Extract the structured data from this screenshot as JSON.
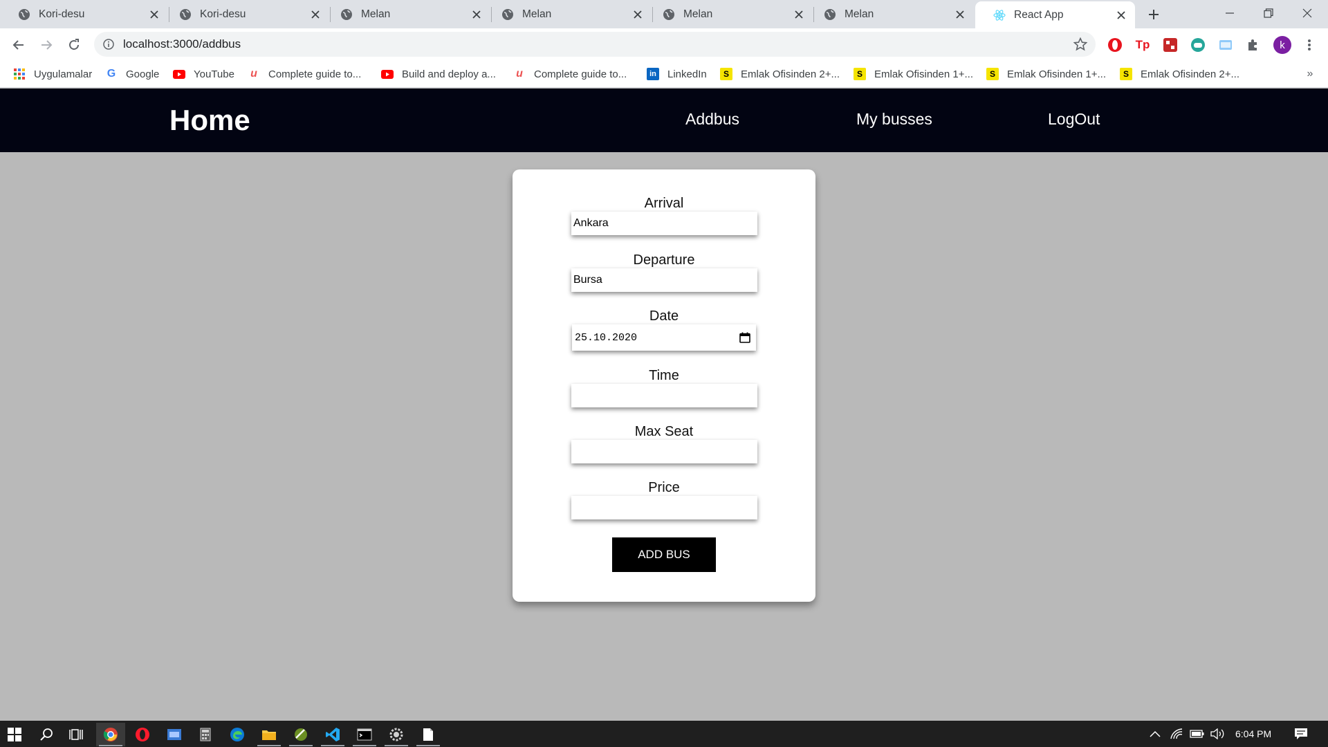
{
  "browser": {
    "tabs": [
      {
        "title": "Kori-desu",
        "active": false
      },
      {
        "title": "Kori-desu",
        "active": false
      },
      {
        "title": "Melan",
        "active": false
      },
      {
        "title": "Melan",
        "active": false
      },
      {
        "title": "Melan",
        "active": false
      },
      {
        "title": "Melan",
        "active": false
      },
      {
        "title": "React App",
        "active": true
      }
    ],
    "url": "localhost:3000/addbus",
    "bookmarks": [
      {
        "label": "Uygulamalar",
        "icon": "apps-grid-icon"
      },
      {
        "label": "Google",
        "icon": "google-icon"
      },
      {
        "label": "YouTube",
        "icon": "youtube-icon"
      },
      {
        "label": "Complete guide to...",
        "icon": "udemy-icon"
      },
      {
        "label": "Build and deploy a...",
        "icon": "youtube-icon"
      },
      {
        "label": "Complete guide to...",
        "icon": "udemy-icon"
      },
      {
        "label": "LinkedIn",
        "icon": "linkedin-icon"
      },
      {
        "label": "Emlak Ofisinden 2+...",
        "icon": "s-icon"
      },
      {
        "label": "Emlak Ofisinden 1+...",
        "icon": "s-icon"
      },
      {
        "label": "Emlak Ofisinden 1+...",
        "icon": "s-icon"
      },
      {
        "label": "Emlak Ofisinden 2+...",
        "icon": "s-icon"
      }
    ],
    "extension_labels": {
      "tp": "Tp"
    },
    "profile_initial": "k",
    "more_bookmarks": "»"
  },
  "app": {
    "brand": "Home",
    "nav": {
      "addbus": "Addbus",
      "mybusses": "My busses",
      "logout": "LogOut"
    },
    "form": {
      "arrival": {
        "label": "Arrival",
        "value": "Ankara"
      },
      "departure": {
        "label": "Departure",
        "value": "Bursa"
      },
      "date": {
        "label": "Date",
        "value": "25.10.2020"
      },
      "time": {
        "label": "Time",
        "value": ""
      },
      "max_seat": {
        "label": "Max Seat",
        "value": ""
      },
      "price": {
        "label": "Price",
        "value": ""
      },
      "submit_label": "ADD BUS"
    }
  },
  "taskbar": {
    "clock": "6:04 PM"
  },
  "colors": {
    "page_bg": "#b9b9b9",
    "navbar_bg": "#020412",
    "button_bg": "#000000",
    "avatar_bg": "#7b1fa2"
  }
}
